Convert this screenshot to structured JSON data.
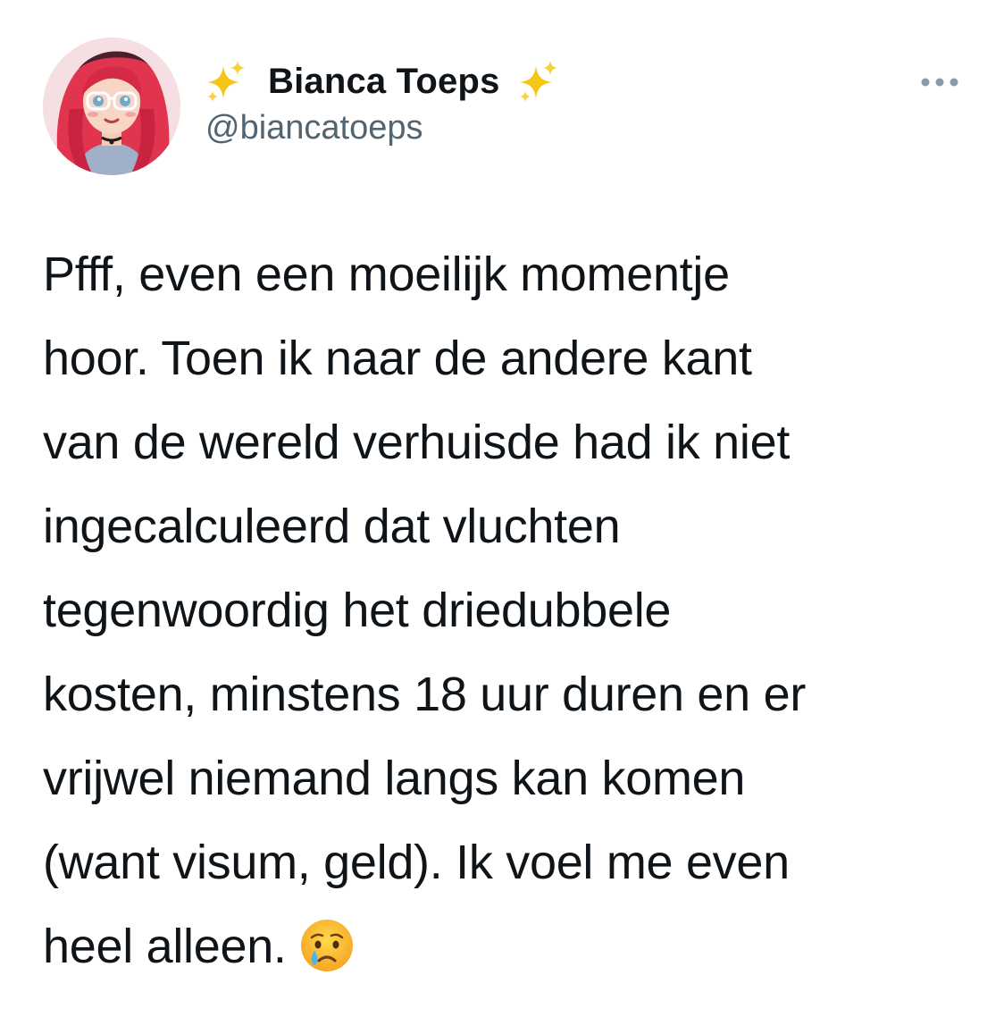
{
  "tweet": {
    "display_name": "Bianca Toeps",
    "handle": "@biancatoeps",
    "name_emoji_left": "sparkles-icon",
    "name_emoji_right": "sparkles-icon",
    "more_icon": "more-horizontal-icon",
    "text_lines": [
      "Pfff, even een moeilijk momentje",
      "hoor. Toen ik naar de andere kant",
      "van de wereld verhuisde had ik niet",
      "ingecalculeerd dat vluchten",
      "tegenwoordig het driedubbele",
      "kosten, minstens 18 uur duren en er",
      "vrijwel niemand langs kan komen",
      "(want visum, geld). Ik voel me even",
      "heel alleen."
    ],
    "trailing_emoji": "crying-face-icon"
  },
  "colors": {
    "text": "#0f1419",
    "secondary": "#536471",
    "more_dots": "#8b98a5",
    "sparkle": "#f5c518"
  }
}
